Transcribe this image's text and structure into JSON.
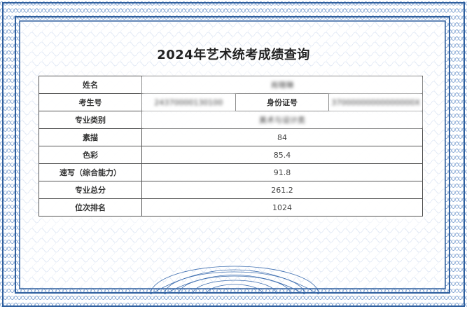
{
  "title": "2024年艺术统考成绩查询",
  "colors": {
    "frame": "#2f5f9e",
    "guilloche": "#5a86c2"
  },
  "rows": {
    "name": {
      "label": "姓名",
      "value": "肖晓琳"
    },
    "exam_no": {
      "label": "考生号",
      "value": "24370000130100",
      "id_label": "身份证号",
      "id_value": "37000000000000000X"
    },
    "category": {
      "label": "专业类别",
      "value": "美术与设计类"
    },
    "sketch": {
      "label": "素描",
      "value": "84"
    },
    "color": {
      "label": "色彩",
      "value": "85.4"
    },
    "quick_sketch": {
      "label": "速写（综合能力）",
      "value": "91.8"
    },
    "total": {
      "label": "专业总分",
      "value": "261.2"
    },
    "rank": {
      "label": "位次排名",
      "value": "1024"
    }
  }
}
